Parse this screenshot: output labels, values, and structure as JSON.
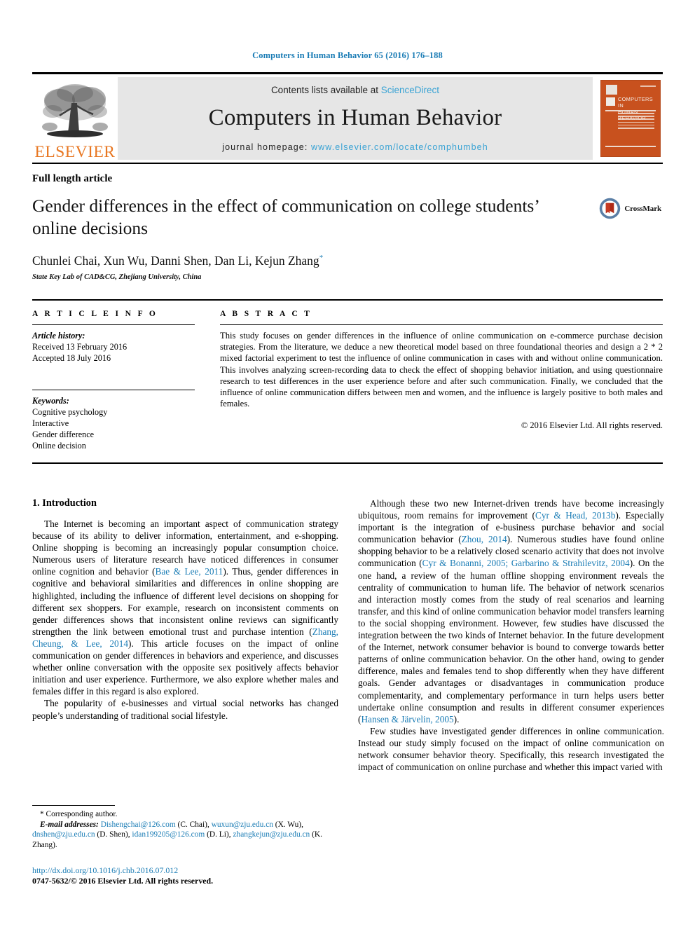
{
  "running_head": "Computers in Human Behavior 65 (2016) 176–188",
  "masthead": {
    "contents_prefix": "Contents lists available at ",
    "sciencedirect": "ScienceDirect",
    "journal_title": "Computers in Human Behavior",
    "homepage_label": "journal homepage: ",
    "homepage_url": "www.elsevier.com/locate/comphumbeh",
    "publisher_wordmark": "ELSEVIER",
    "cover_title_line1": "COMPUTERS IN",
    "cover_title_line2": "HUMAN BEHAVIOR",
    "accent_blue": "#3aa3d4",
    "elsevier_orange": "#E87722",
    "cover_orange": "#c8511e"
  },
  "article": {
    "type": "Full length article",
    "title": "Gender differences in the effect of communication on college students’ online decisions",
    "authors": "Chunlei Chai, Xun Wu, Danni Shen, Dan Li, Kejun Zhang",
    "corresponding_marker": "*",
    "affiliation": "State Key Lab of CAD&CG, Zhejiang University, China",
    "crossmark_label": "CrossMark"
  },
  "info": {
    "heading": "A R T I C L E   I N F O",
    "history_label": "Article history:",
    "received": "Received 13 February 2016",
    "accepted": "Accepted 18 July 2016",
    "keywords_label": "Keywords:",
    "keywords": [
      "Cognitive psychology",
      "Interactive",
      "Gender difference",
      "Online decision"
    ]
  },
  "abstract": {
    "heading": "A B S T R A C T",
    "text": "This study focuses on gender differences in the influence of online communication on e-commerce purchase decision strategies. From the literature, we deduce a new theoretical model based on three foundational theories and design a 2 * 2 mixed factorial experiment to test the influence of online communication in cases with and without online communication. This involves analyzing screen-recording data to check the effect of shopping behavior initiation, and using questionnaire research to test differences in the user experience before and after such communication. Finally, we concluded that the influence of online communication differs between men and women, and the influence is largely positive to both males and females.",
    "copyright": "© 2016 Elsevier Ltd. All rights reserved."
  },
  "body": {
    "section_title": "1. Introduction",
    "left_paragraphs": [
      {
        "runs": [
          {
            "t": "The Internet is becoming an important aspect of communication strategy because of its ability to deliver information, entertainment, and e-shopping. Online shopping is becoming an increasingly popular consumption choice. Numerous users of literature research have noticed differences in consumer online cognition and behavior ("
          },
          {
            "t": "Bae & Lee, 2011",
            "ref": true
          },
          {
            "t": "). Thus, gender differences in cognitive and behavioral similarities and differences in online shopping are highlighted, including the influence of different level decisions on shopping for different sex shoppers. For example, research on inconsistent comments on gender differences shows that inconsistent online reviews can significantly strengthen the link between emotional trust and purchase intention ("
          },
          {
            "t": "Zhang, Cheung, & Lee, 2014",
            "ref": true
          },
          {
            "t": "). This article focuses on the impact of online communication on gender differences in behaviors and experience, and discusses whether online conversation with the opposite sex positively affects behavior initiation and user experience. Furthermore, we also explore whether males and females differ in this regard is also explored."
          }
        ]
      },
      {
        "runs": [
          {
            "t": "The popularity of e-businesses and virtual social networks has changed people’s understanding of traditional social lifestyle."
          }
        ]
      }
    ],
    "right_paragraphs": [
      {
        "runs": [
          {
            "t": "Although these two new Internet-driven trends have become increasingly ubiquitous, room remains for improvement ("
          },
          {
            "t": "Cyr & Head, 2013b",
            "ref": true
          },
          {
            "t": "). Especially important is the integration of e-business purchase behavior and social communication behavior ("
          },
          {
            "t": "Zhou, 2014",
            "ref": true
          },
          {
            "t": "). Numerous studies have found online shopping behavior to be a relatively closed scenario activity that does not involve communication ("
          },
          {
            "t": "Cyr & Bonanni, 2005; Garbarino & Strahilevitz, 2004",
            "ref": true
          },
          {
            "t": "). On the one hand, a review of the human offline shopping environment reveals the centrality of communication to human life. The behavior of network scenarios and interaction mostly comes from the study of real scenarios and learning transfer, and this kind of online communication behavior model transfers learning to the social shopping environment. However, few studies have discussed the integration between the two kinds of Internet behavior. In the future development of the Internet, network consumer behavior is bound to converge towards better patterns of online communication behavior. On the other hand, owing to gender difference, males and females tend to shop differently when they have different goals. Gender advantages or disadvantages in communication produce complementarity, and complementary performance in turn helps users better undertake online consumption and results in different consumer experiences ("
          },
          {
            "t": "Hansen & Järvelin, 2005",
            "ref": true
          },
          {
            "t": ")."
          }
        ]
      },
      {
        "runs": [
          {
            "t": "Few studies have investigated gender differences in online communication. Instead our study simply focused on the impact of online communication on network consumer behavior theory. Specifically, this research investigated the impact of communication on online purchase and whether this impact varied with"
          }
        ]
      }
    ]
  },
  "footnote": {
    "corresponding": "* Corresponding author.",
    "email_label": "E-mail addresses:",
    "emails": [
      {
        "addr": "Dishengchai@126.com",
        "name": " (C. Chai), "
      },
      {
        "addr": "wuxun@zju.edu.cn",
        "name": " (X. Wu), "
      },
      {
        "addr": "dnshen@zju.edu.cn",
        "name": " (D. Shen), "
      },
      {
        "addr": "idan199205@126.com",
        "name": " (D. Li), "
      },
      {
        "addr": "zhangkejun@zju.edu.cn",
        "name": " (K. Zhang)."
      }
    ],
    "doi": "http://dx.doi.org/10.1016/j.chb.2016.07.012",
    "issn": "0747-5632/© 2016 Elsevier Ltd. All rights reserved."
  }
}
